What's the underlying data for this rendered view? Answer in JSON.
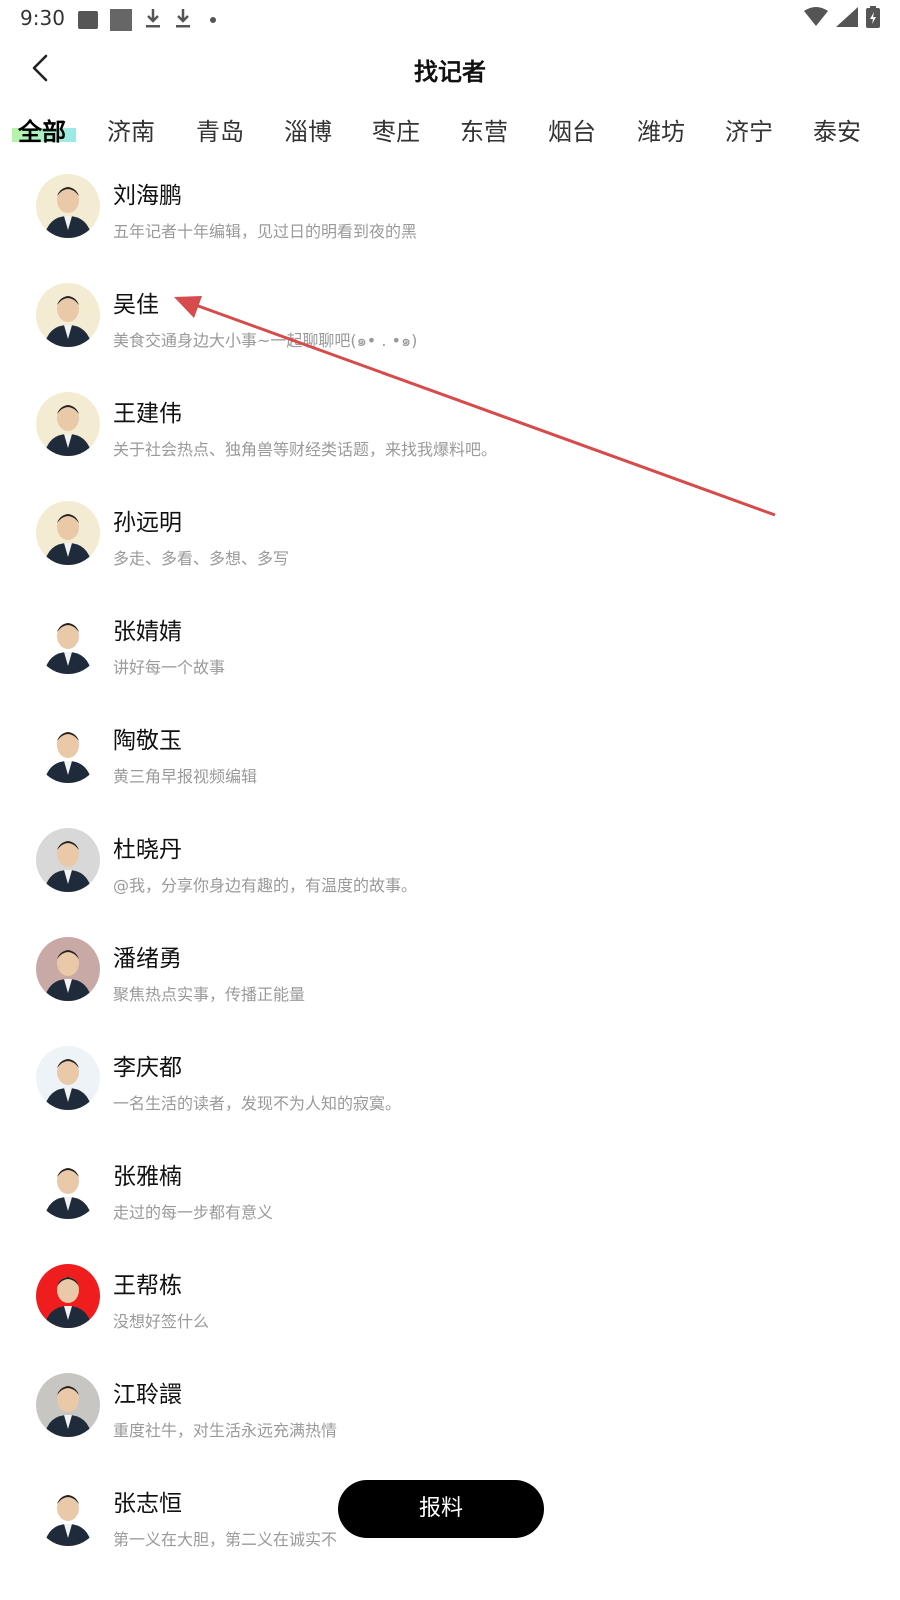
{
  "status": {
    "time": "9:30"
  },
  "header": {
    "title": "找记者"
  },
  "tabs": [
    {
      "label": "全部",
      "active": true
    },
    {
      "label": "济南"
    },
    {
      "label": "青岛"
    },
    {
      "label": "淄博"
    },
    {
      "label": "枣庄"
    },
    {
      "label": "东营"
    },
    {
      "label": "烟台"
    },
    {
      "label": "潍坊"
    },
    {
      "label": "济宁"
    },
    {
      "label": "泰安"
    }
  ],
  "reporters": [
    {
      "name": "刘海鹏",
      "desc": "五年记者十年编辑，见过日的明看到夜的黑",
      "bg": "#f3ecd2"
    },
    {
      "name": "吴佳",
      "desc": "美食交通身边大小事~一起聊聊吧(๑• . •๑)",
      "bg": "#f3ecd2"
    },
    {
      "name": "王建伟",
      "desc": "关于社会热点、独角兽等财经类话题，来找我爆料吧。",
      "bg": "#f3ecd2"
    },
    {
      "name": "孙远明",
      "desc": "多走、多看、多想、多写",
      "bg": "#f3ecd2"
    },
    {
      "name": "张婧婧",
      "desc": "讲好每一个故事",
      "bg": "#ffffff"
    },
    {
      "name": "陶敬玉",
      "desc": "黄三角早报视频编辑",
      "bg": "#ffffff"
    },
    {
      "name": "杜晓丹",
      "desc": "@我，分享你身边有趣的，有温度的故事。",
      "bg": "#d8d8d8"
    },
    {
      "name": "潘绪勇",
      "desc": "聚焦热点实事，传播正能量",
      "bg": "#c9a9a6"
    },
    {
      "name": "李庆都",
      "desc": "一名生活的读者，发现不为人知的寂寞。",
      "bg": "#eef3f8"
    },
    {
      "name": "张雅楠",
      "desc": "走过的每一步都有意义",
      "bg": "#ffffff"
    },
    {
      "name": "王帮栋",
      "desc": "没想好签什么",
      "bg": "#ef1d1d"
    },
    {
      "name": "江聆譞",
      "desc": "重度社牛，对生活永远充满热情",
      "bg": "#c8c6c3"
    },
    {
      "name": "张志恒",
      "desc": "第一义在大胆，第二义在诚实不",
      "bg": "#ffffff"
    }
  ],
  "report_button": {
    "label": "报料"
  },
  "colors": {
    "accent_gradient_start": "#b6f5a4",
    "accent_gradient_end": "#9be8ea",
    "arrow": "#d64b4b"
  },
  "icons": {
    "back": "back-arrow-icon",
    "wifi": "wifi-icon",
    "signal": "signal-icon",
    "battery": "battery-icon"
  }
}
